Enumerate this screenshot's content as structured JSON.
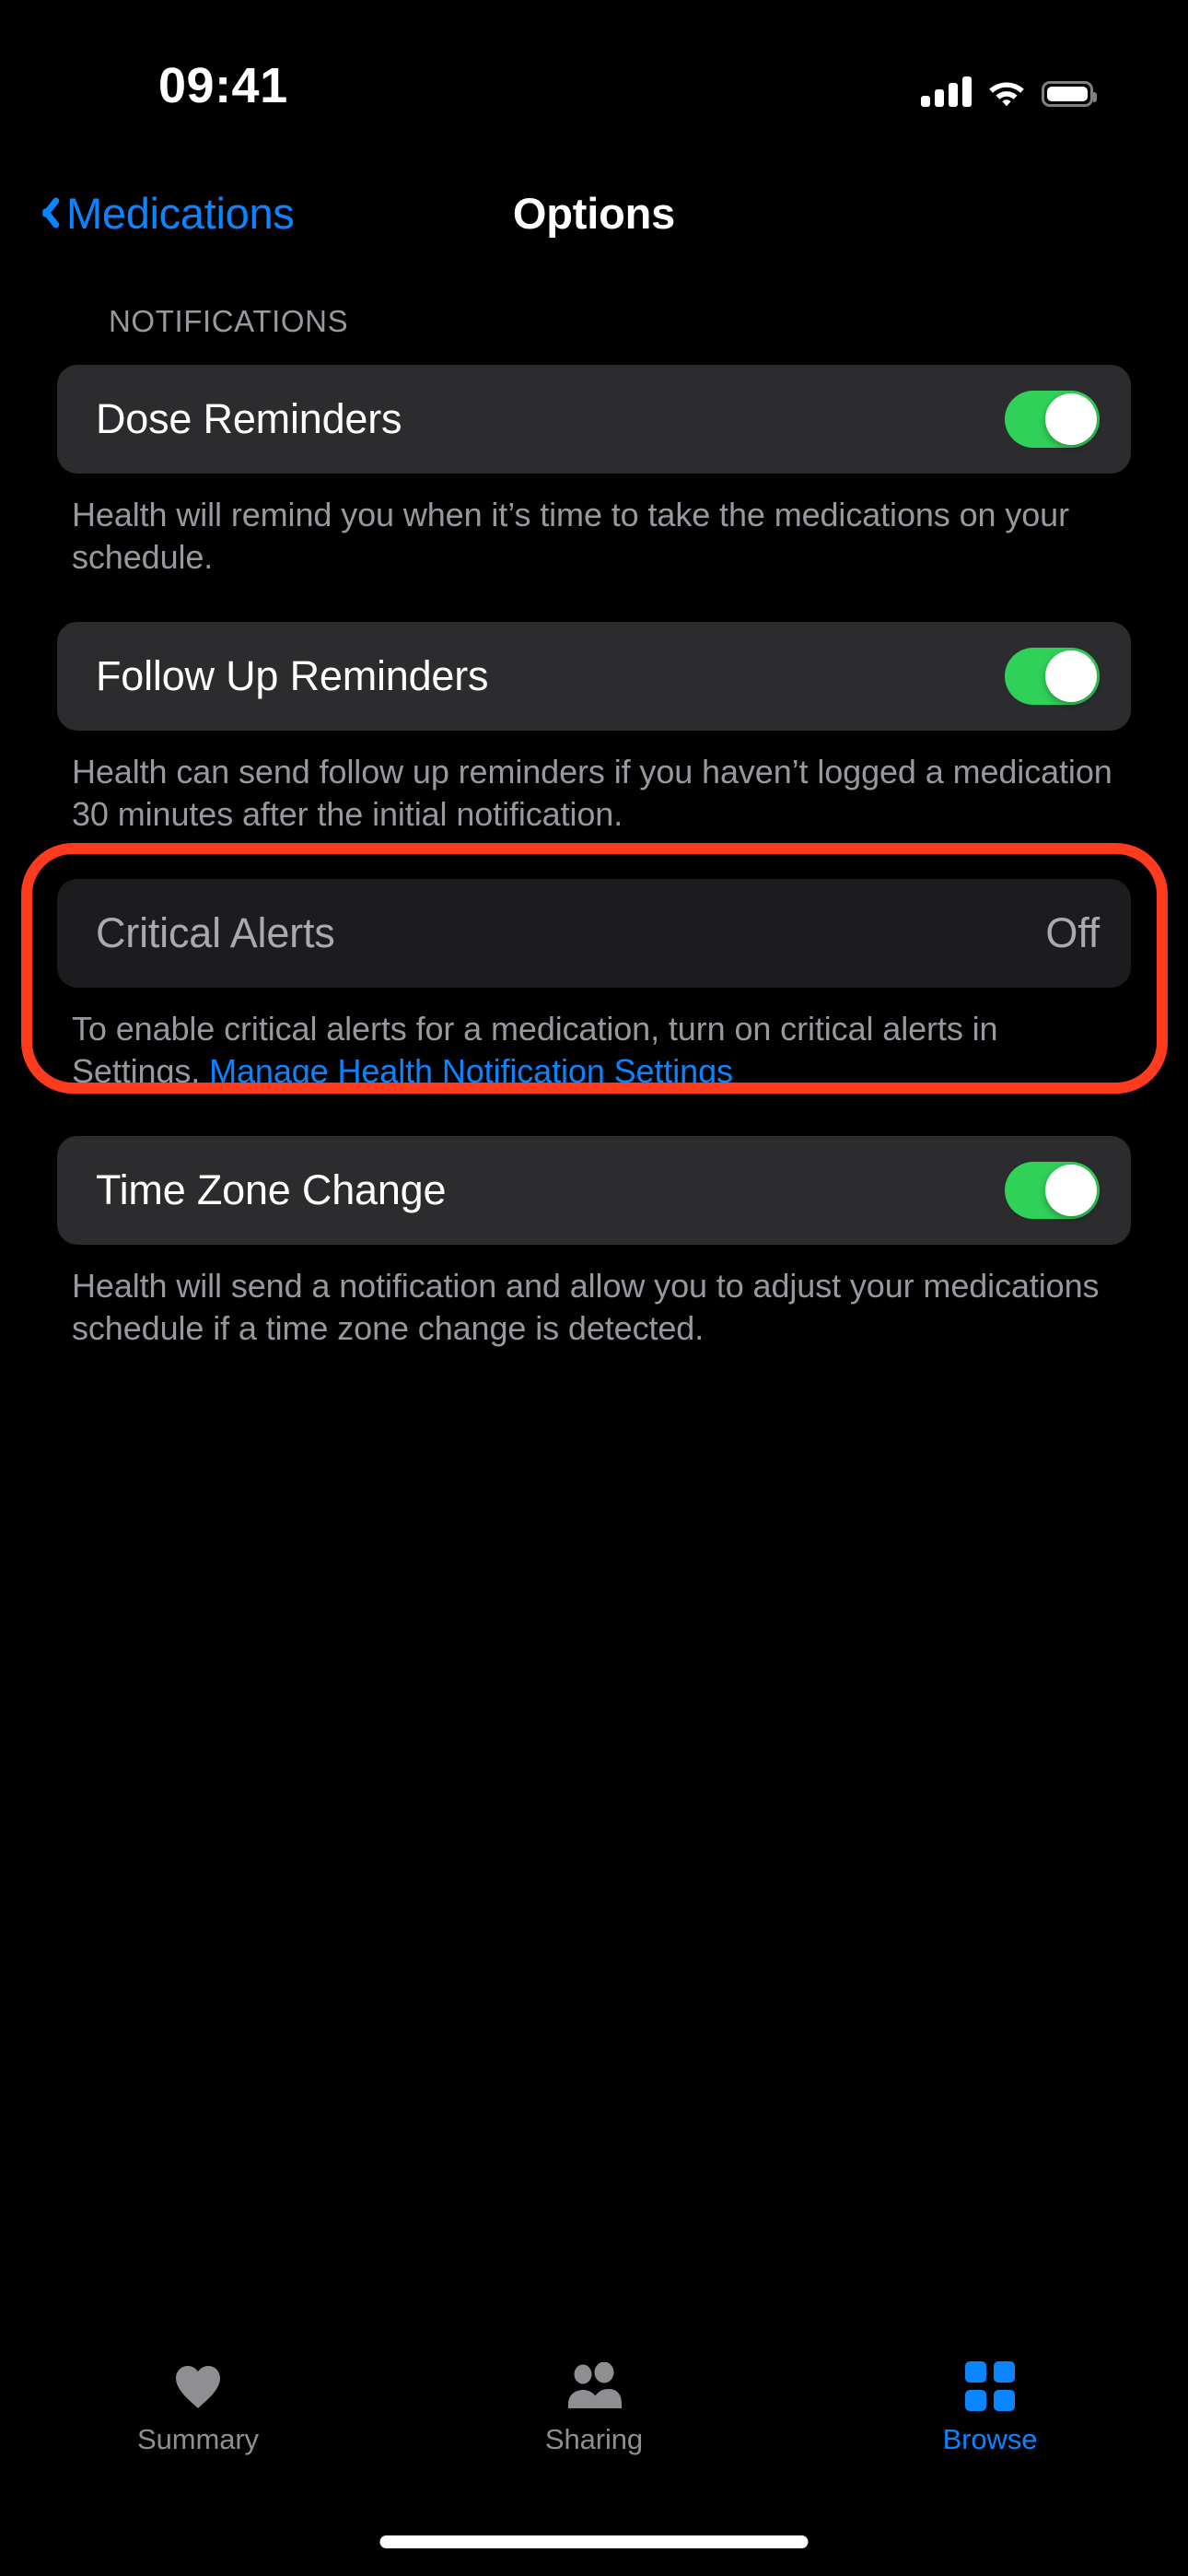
{
  "status_bar": {
    "time": "09:41",
    "cellular_icon": "cellular-bars-icon",
    "wifi_icon": "wifi-icon",
    "battery_icon": "battery-full-icon"
  },
  "nav": {
    "back_label": "Medications",
    "back_icon": "chevron-left-icon",
    "title": "Options"
  },
  "colors": {
    "accent_blue": "#0a84ff",
    "toggle_green": "#30d158",
    "annotation_red": "#ff3b1f",
    "row_background": "#2c2c2e",
    "row_disabled_background": "#1c1c1e",
    "secondary_text": "#98989f"
  },
  "section": {
    "header": "NOTIFICATIONS",
    "rows": [
      {
        "label": "Dose Reminders",
        "control": "toggle",
        "value": "On",
        "footer": "Health will remind you when it’s time to take the medications on your schedule.",
        "disabled": false
      },
      {
        "label": "Follow Up Reminders",
        "control": "toggle",
        "value": "On",
        "footer": "Health can send follow up reminders if you haven’t logged a medication 30 minutes after the initial notification.",
        "disabled": false
      },
      {
        "label": "Critical Alerts",
        "control": "value",
        "value": "Off",
        "footer_prefix": "To enable critical alerts for a medication, turn on critical alerts in Settings. ",
        "footer_link": "Manage Health Notification Settings",
        "disabled": true,
        "highlighted": true
      },
      {
        "label": "Time Zone Change",
        "control": "toggle",
        "value": "On",
        "footer": "Health will send a notification and allow you to adjust your medications schedule if a time zone change is detected.",
        "disabled": false
      }
    ]
  },
  "tabbar": {
    "tabs": [
      {
        "label": "Summary",
        "icon": "heart-icon",
        "active": false
      },
      {
        "label": "Sharing",
        "icon": "people-icon",
        "active": false
      },
      {
        "label": "Browse",
        "icon": "grid-squares-icon",
        "active": true
      }
    ]
  }
}
